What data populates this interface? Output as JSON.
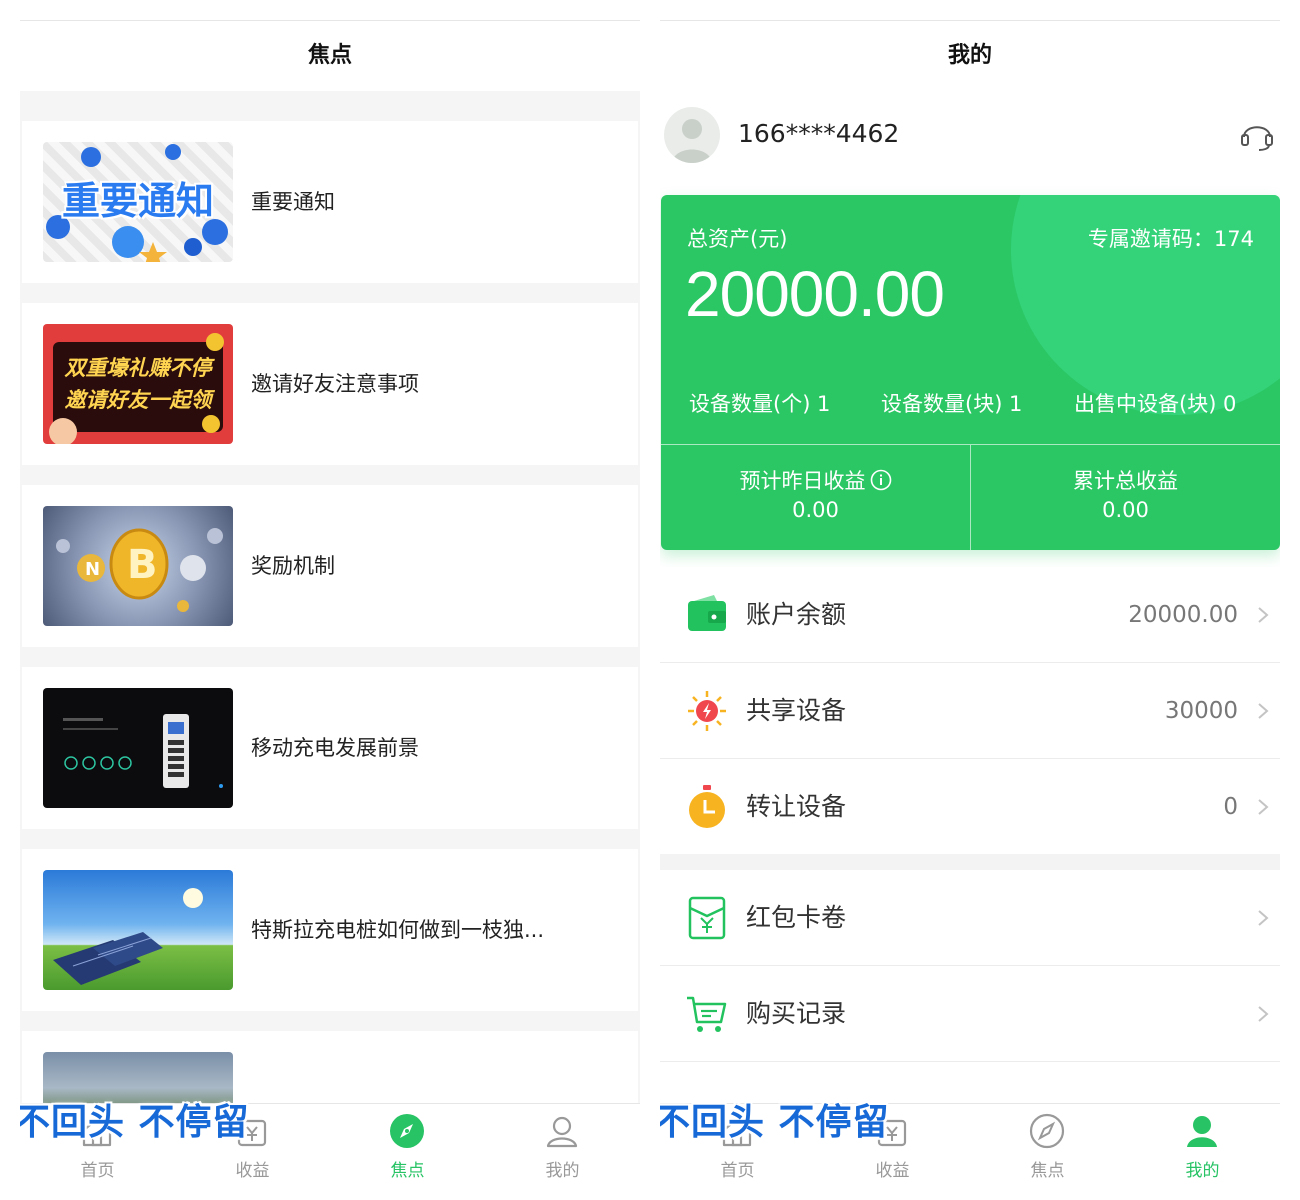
{
  "focus_page": {
    "title": "焦点",
    "news": [
      {
        "title": "重要通知",
        "thumb_text": "重要通知"
      },
      {
        "title": "邀请好友注意事项",
        "thumb_text_1": "双重壕礼赚不停",
        "thumb_text_2": "邀请好友一起领"
      },
      {
        "title": "奖励机制"
      },
      {
        "title": "移动充电发展前景"
      },
      {
        "title": "特斯拉充电桩如何做到一枝独..."
      },
      {
        "title": ""
      }
    ],
    "overlay_caption": "不回头 不停留"
  },
  "mine_page": {
    "title": "我的",
    "user": {
      "phone": "166****4462"
    },
    "assets": {
      "label": "总资产(元)",
      "amount": "20000.00",
      "invite_code": "专属邀请码：174",
      "stats": [
        {
          "label": "设备数量(个) 1"
        },
        {
          "label": "设备数量(块) 1"
        },
        {
          "label": "出售中设备(块) 0"
        }
      ],
      "yesterday_label": "预计昨日收益",
      "yesterday_value": "0.00",
      "total_label": "累计总收益",
      "total_value": "0.00"
    },
    "menu": [
      {
        "label": "账户余额",
        "value": "20000.00",
        "icon": "wallet-icon",
        "color": "#22c35e"
      },
      {
        "label": "共享设备",
        "value": "30000",
        "icon": "sun-device-icon",
        "color": "#f0474e"
      },
      {
        "label": "转让设备",
        "value": "0",
        "icon": "timer-icon",
        "color": "#f7b320"
      },
      {
        "label": "红包卡卷",
        "value": "",
        "icon": "red-envelope-icon",
        "color": "#22c35e"
      },
      {
        "label": "购买记录",
        "value": "",
        "icon": "cart-icon",
        "color": "#22c35e"
      }
    ],
    "overlay_caption": "不回头 不停留"
  },
  "tabbar": {
    "tabs": [
      {
        "label": "首页",
        "icon": "home-icon"
      },
      {
        "label": "收益",
        "icon": "earnings-icon"
      },
      {
        "label": "焦点",
        "icon": "compass-icon"
      },
      {
        "label": "我的",
        "icon": "user-icon"
      }
    ]
  },
  "colors": {
    "accent": "#27c364",
    "card": "#2cc765",
    "caption": "#1769d8"
  }
}
